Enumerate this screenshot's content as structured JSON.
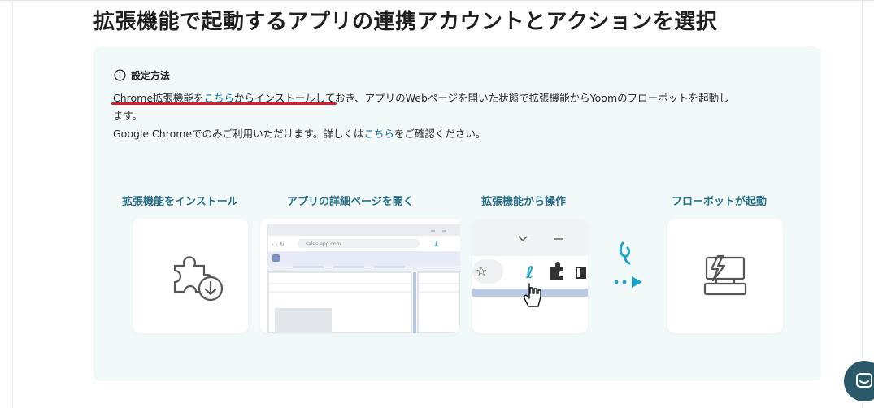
{
  "page": {
    "title": "拡張機能で起動するアプリの連携アカウントとアクションを選択"
  },
  "setup": {
    "title": "設定方法",
    "line1_part1": "Chrome拡張機能を",
    "line1_link": "こちら",
    "line1_part2": "からインストールしておき、アプリのWebページを開いた状態で拡張機能からYoomのフローボットを起動し",
    "line1_cont": "ます。",
    "line2_part1": "Google Chromeでのみご利用いただけます。詳しくは",
    "line2_link": "こちら",
    "line2_part2": "をご確認ください。"
  },
  "steps": [
    {
      "label": "拡張機能をインストール",
      "icon": "puzzle-download-icon"
    },
    {
      "label": "アプリの詳細ページを開く",
      "icon": "browser-window-icon",
      "url_text": "sales.app.com"
    },
    {
      "label": "拡張機能から操作",
      "icon": "extension-toolbar-icon"
    },
    {
      "label": "フローボットが起動",
      "icon": "flowbot-launch-icon"
    }
  ],
  "colors": {
    "panel_bg": "#f1f9f9",
    "accent_teal": "#2a6f86",
    "link": "#1d6e9e",
    "brand_cyan": "#1aa3c8",
    "underline_red": "#d4202a",
    "chat_bg": "#2a5a6a"
  },
  "icons": {
    "info": "info-icon",
    "chat": "chat-icon",
    "arrow": "flow-arrow-icon"
  }
}
